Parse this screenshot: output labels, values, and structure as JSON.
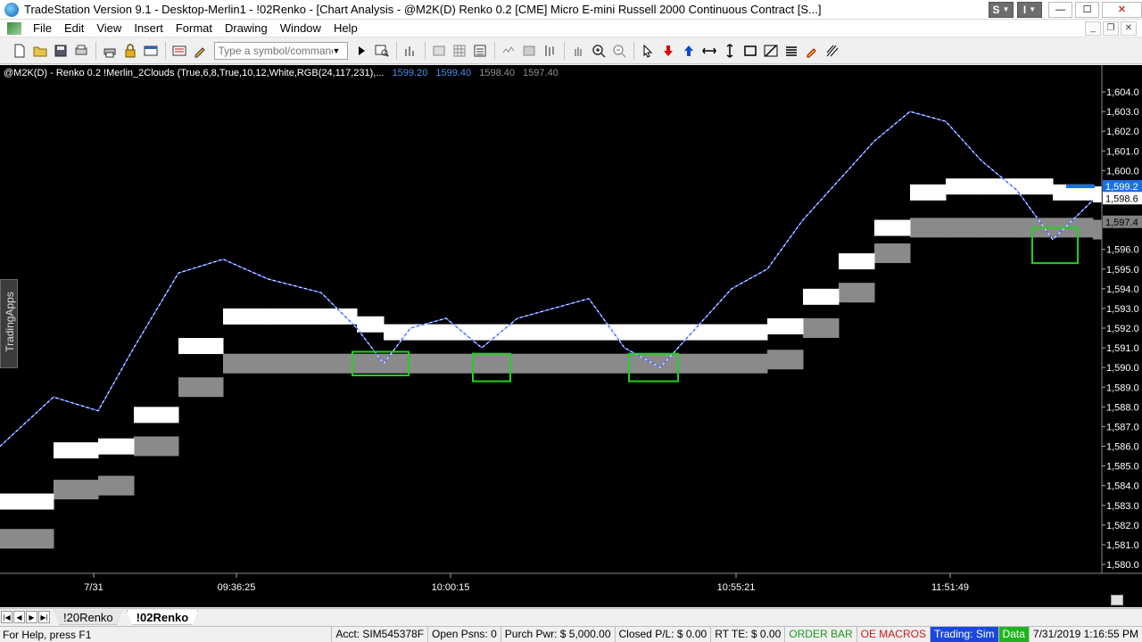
{
  "window": {
    "title": "TradeStation Version 9.1 - Desktop-Merlin1 - !02Renko - [Chart Analysis - @M2K(D) Renko 0.2 [CME] Micro E-mini Russell 2000 Continuous Contract [S...]",
    "s_button": "S",
    "i_button": "I",
    "minimize": "—",
    "maximize": "☐",
    "close": "✕"
  },
  "menu": {
    "items": [
      "File",
      "Edit",
      "View",
      "Insert",
      "Format",
      "Drawing",
      "Window",
      "Help"
    ],
    "mdi": [
      "_",
      "❐",
      "✕"
    ]
  },
  "toolbar": {
    "symbol_placeholder": "Type a symbol/command",
    "dropdown_glyph": "▼",
    "icons": [
      "new-doc-icon",
      "open-folder-icon",
      "save-icon",
      "print-setup-icon",
      "print-icon",
      "lock-icon",
      "workspace-icon",
      "link-icon",
      "pencil-icon",
      "go-arrow-icon",
      "symbol-lookup-icon",
      "bar-chart-icon",
      "data-window-icon",
      "grid-icon",
      "drawing-icon",
      "hand-icon",
      "zoom-in-icon",
      "zoom-out-icon",
      "pointer-icon",
      "sell-arrow-icon",
      "buy-arrow-icon",
      "horizontal-line-icon",
      "vertical-line-icon",
      "rectangle-icon",
      "trendline-icon",
      "menu-icon",
      "marker-icon",
      "hatch-icon"
    ]
  },
  "chart": {
    "header_text": "@M2K(D) - Renko 0.2  !Merlin_2Clouds (True,6,8,True,10,12,White,RGB(24,117,231),...",
    "header_values": [
      "1599.20",
      "1599.40",
      "1598.40",
      "1597.40"
    ],
    "side_tab": "TradingApps",
    "price_labels": [
      "1,604.0",
      "1,603.0",
      "1,602.0",
      "1,601.0",
      "1,600.0",
      "1,596.0",
      "1,595.0",
      "1,594.0",
      "1,593.0",
      "1,592.0",
      "1,591.0",
      "1,590.0",
      "1,589.0",
      "1,588.0",
      "1,587.0",
      "1,586.0",
      "1,585.0",
      "1,584.0",
      "1,583.0",
      "1,582.0",
      "1,581.0",
      "1,580.0"
    ],
    "price_min": 1580,
    "price_max": 1604,
    "price_tags": [
      {
        "label": "1,599.2",
        "price": 1599.2,
        "bg": "#1a6fe8",
        "fg": "#ffffff"
      },
      {
        "label": "1,598.6",
        "price": 1598.6,
        "bg": "#ffffff",
        "fg": "#000000"
      },
      {
        "label": "1,597.4",
        "price": 1597.4,
        "bg": "#808080",
        "fg": "#000000"
      }
    ],
    "time_labels": [
      "7/31",
      "09:36:25",
      "10:00:15",
      "10:55:21",
      "11:51:49"
    ],
    "colors": {
      "background": "#000000",
      "price_line": "#ffffff",
      "price_line_down": "#3a63ff",
      "upper_cloud": "#ffffff",
      "lower_cloud": "#8a8a8a",
      "highlight_box": "#1fd11f",
      "price_tag_blue": "#1a6fe8"
    }
  },
  "chart_data": {
    "type": "line",
    "title": "",
    "series": [
      {
        "x": [
          0,
          60,
          110,
          150,
          200,
          250,
          300,
          360,
          400,
          430,
          460,
          500,
          540,
          580,
          620,
          660,
          700,
          740,
          780,
          820,
          860,
          900,
          940,
          980,
          1020,
          1060,
          1100,
          1140,
          1180,
          1225
        ],
        "values": [
          1586.0,
          1588.5,
          1587.8,
          1591.0,
          1594.8,
          1595.5,
          1594.5,
          1593.8,
          1592.0,
          1590.2,
          1592.0,
          1592.5,
          1591.0,
          1592.5,
          1593.0,
          1593.5,
          1591.0,
          1590.0,
          1592.0,
          1594.0,
          1595.0,
          1597.5,
          1599.5,
          1601.5,
          1603.0,
          1602.5,
          1600.5,
          1599.0,
          1596.5,
          1598.5
        ]
      },
      {
        "name": "upper cloud",
        "values": [
          1583.6,
          1586.2,
          1586.4,
          1588.0,
          1591.5,
          1593.0,
          1593.0,
          1593.0,
          1592.6,
          1592.2,
          1592.2,
          1592.2,
          1592.2,
          1592.2,
          1592.2,
          1592.2,
          1592.2,
          1592.2,
          1592.2,
          1592.2,
          1592.5,
          1594.0,
          1595.8,
          1597.5,
          1599.3,
          1599.6,
          1599.6,
          1599.6,
          1599.3,
          1599.2
        ]
      },
      {
        "name": "lower cloud",
        "values": [
          1581.8,
          1584.3,
          1584.5,
          1586.5,
          1589.5,
          1590.7,
          1590.7,
          1590.7,
          1590.7,
          1590.7,
          1590.7,
          1590.7,
          1590.7,
          1590.7,
          1590.7,
          1590.7,
          1590.7,
          1590.7,
          1590.7,
          1590.7,
          1590.9,
          1592.5,
          1594.3,
          1596.3,
          1597.6,
          1597.6,
          1597.6,
          1597.6,
          1597.6,
          1597.5
        ]
      }
    ],
    "highlight_boxes": [
      {
        "x_from": 395,
        "x_to": 458,
        "price_top": 1590.8,
        "price_bottom": 1589.6
      },
      {
        "x_from": 530,
        "x_to": 572,
        "price_top": 1590.7,
        "price_bottom": 1589.3
      },
      {
        "x_from": 705,
        "x_to": 760,
        "price_top": 1590.7,
        "price_bottom": 1589.3
      },
      {
        "x_from": 1157,
        "x_to": 1208,
        "price_top": 1597.1,
        "price_bottom": 1595.3
      }
    ],
    "ylim": [
      1580,
      1604.5
    ],
    "grid": false,
    "legend": "none"
  },
  "tabs": {
    "nav": [
      "|◀",
      "◀",
      "▶",
      "▶|"
    ],
    "items": [
      {
        "label": "!20Renko",
        "active": false
      },
      {
        "label": "!02Renko",
        "active": true
      }
    ]
  },
  "status": {
    "help": "For Help, press F1",
    "acct": "Acct: SIM545378F",
    "open_psns": "Open Psns: 0",
    "purch_pwr": "Purch Pwr: $ 5,000.00",
    "closed_pl": "Closed P/L: $ 0.00",
    "rt_te": "RT TE: $ 0.00",
    "order_bar": "ORDER BAR",
    "oe_macros": "OE MACROS",
    "trading": "Trading: Sim",
    "data": "Data",
    "datetime": "7/31/2019 1:16:55 PM"
  }
}
